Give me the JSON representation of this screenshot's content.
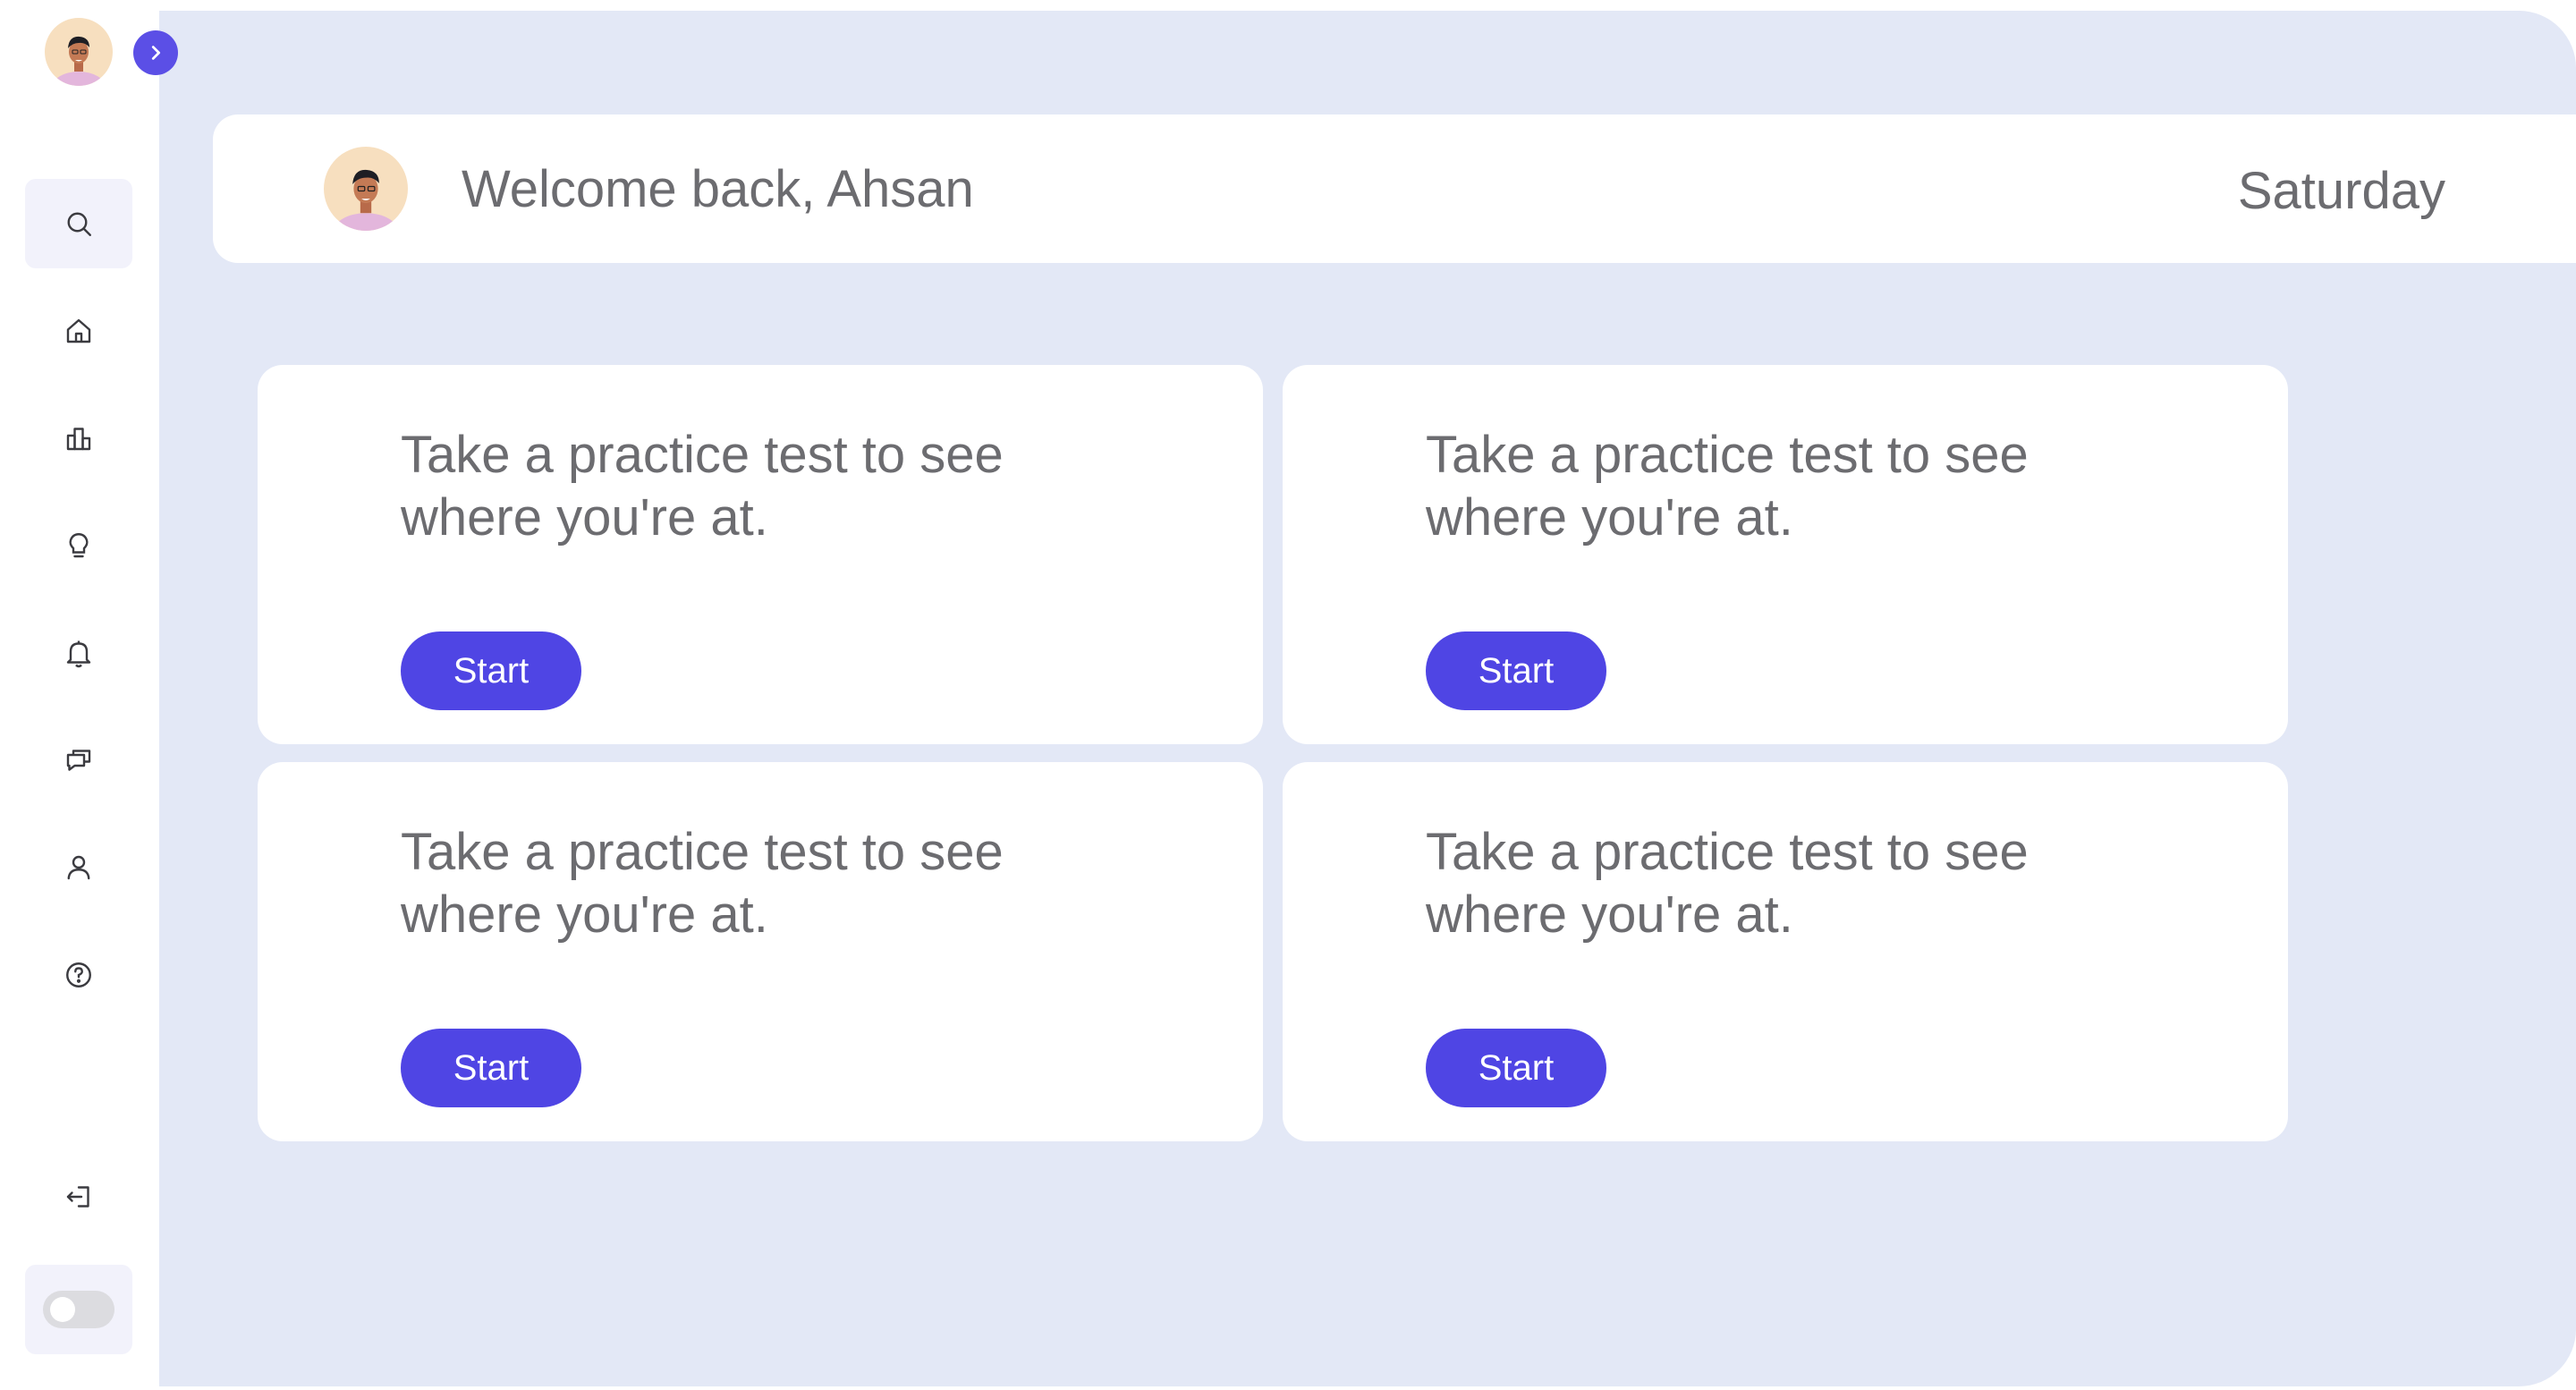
{
  "sidebar": {
    "nav_items": [
      {
        "name": "search",
        "icon": "search-icon",
        "active": true
      },
      {
        "name": "home",
        "icon": "home-icon"
      },
      {
        "name": "stats",
        "icon": "bar-chart-icon"
      },
      {
        "name": "ideas",
        "icon": "lightbulb-icon"
      },
      {
        "name": "notifications",
        "icon": "bell-icon"
      },
      {
        "name": "messages",
        "icon": "chat-icon"
      },
      {
        "name": "profile",
        "icon": "user-icon"
      },
      {
        "name": "help",
        "icon": "help-icon"
      },
      {
        "name": "logout",
        "icon": "logout-icon"
      }
    ],
    "theme_toggle": {
      "on": false
    }
  },
  "header": {
    "welcome": "Welcome back, Ahsan",
    "day": "Saturday"
  },
  "cards": [
    {
      "message": "Take a practice test to see where you're at.",
      "button": "Start"
    },
    {
      "message": "Take a practice test to see where you're at.",
      "button": "Start"
    },
    {
      "message": "Take a practice test to see where you're at.",
      "button": "Start"
    },
    {
      "message": "Take a practice test to see where you're at.",
      "button": "Start"
    }
  ],
  "colors": {
    "accent": "#4f45e4",
    "background": "#e3e8f6",
    "avatar_bg": "#f7dfbf"
  }
}
